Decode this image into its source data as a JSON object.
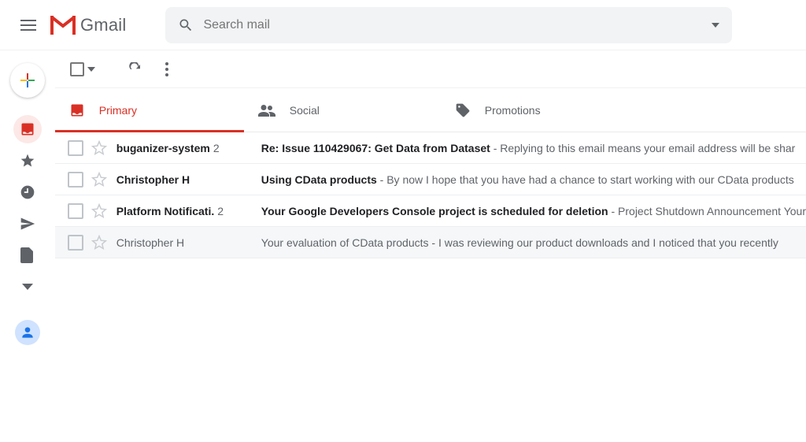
{
  "header": {
    "app_name": "Gmail",
    "search_placeholder": "Search mail"
  },
  "tabs": {
    "primary": "Primary",
    "social": "Social",
    "promotions": "Promotions"
  },
  "rows": [
    {
      "sender": "buganizer-system",
      "count": "2",
      "subject": "Re: Issue 110429067: Get Data from Dataset",
      "snippet": " - Replying to this email means your email address will be shar",
      "unread": true
    },
    {
      "sender": "Christopher H",
      "count": "",
      "subject": "Using CData products",
      "snippet": " - By now I hope that you have had a chance to start working with our CData products",
      "unread": true
    },
    {
      "sender": "Platform Notificati.",
      "count": "2",
      "subject": "Your Google Developers Console project is scheduled for deletion",
      "snippet": " - Project Shutdown Announcement Your",
      "unread": true
    },
    {
      "sender": "Christopher H",
      "count": "",
      "subject": "Your evaluation of CData products",
      "snippet": " - I was reviewing our product downloads and I noticed that you recently",
      "unread": false
    }
  ]
}
